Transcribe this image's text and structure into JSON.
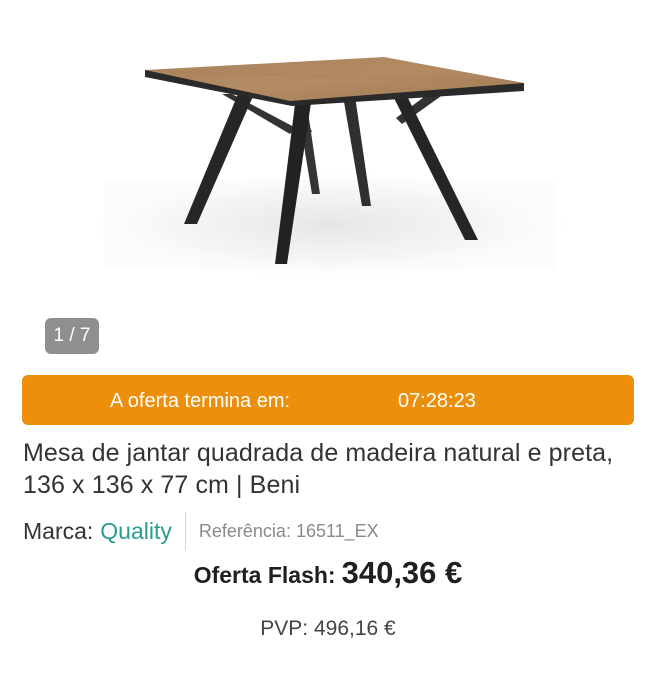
{
  "gallery": {
    "pager": "1 / 7",
    "image_icon": "table-product-image"
  },
  "offer": {
    "label": "A oferta termina em:",
    "timer": "07:28:23",
    "color": "#ec8f0c"
  },
  "product": {
    "title": "Mesa de jantar quadrada de madeira natural e preta, 136 x 136 x 77 cm | Beni",
    "brand_label": "Marca:",
    "brand_name": "Quality",
    "brand_color": "#2a9d8f",
    "reference": "Referência: 16511_EX"
  },
  "pricing": {
    "flash_label": "Oferta Flash:",
    "flash_price": "340,36 €",
    "pvp": "PVP: 496,16 €"
  }
}
